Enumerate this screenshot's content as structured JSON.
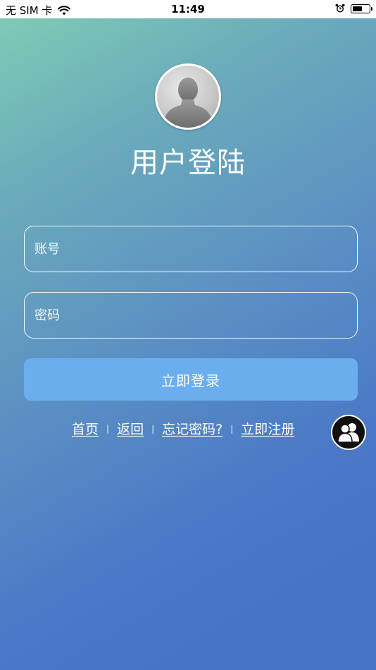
{
  "status_bar": {
    "carrier": "无 SIM 卡",
    "time": "11:49",
    "battery_level_fraction": 0.6
  },
  "header": {
    "title": "用户登陆"
  },
  "form": {
    "account_placeholder": "账号",
    "password_placeholder": "密码",
    "login_label": "立即登录"
  },
  "links": {
    "home": "首页",
    "back": "返回",
    "forgot": "忘记密码?",
    "register": "立即注册"
  },
  "colors": {
    "gradient_top": "#7fcab5",
    "gradient_bottom": "#4472c4",
    "login_button": "#6aaeee"
  },
  "icons": {
    "avatar": "user-silhouette-icon",
    "float_button": "users-icon",
    "wifi": "wifi-icon",
    "alarm": "alarm-icon",
    "battery": "battery-icon"
  }
}
